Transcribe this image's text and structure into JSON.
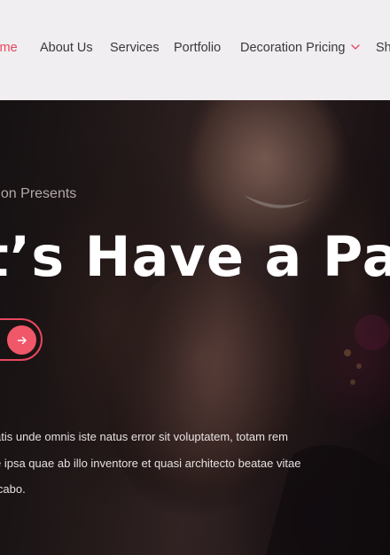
{
  "nav": {
    "items": [
      {
        "label": "Home",
        "active": true
      },
      {
        "label": "About Us",
        "active": false
      },
      {
        "label": "Services",
        "active": false
      },
      {
        "label": "Portfolio",
        "active": false
      },
      {
        "label": "Decoration Pricing",
        "active": false,
        "icon": "chevron-down-icon"
      },
      {
        "label": "Sh",
        "active": false
      }
    ],
    "active_color": "#e8475f"
  },
  "hero": {
    "eyebrow": "ation Presents",
    "title": "t’s Have a Par",
    "cta": {
      "icon": "arrow-right-icon",
      "color": "#e8475f"
    },
    "body_lines": [
      "atis unde omnis iste natus error sit voluptatem, totam rem",
      "e ipsa quae ab illo inventore et quasi architecto beatae vitae",
      "icabo."
    ]
  }
}
